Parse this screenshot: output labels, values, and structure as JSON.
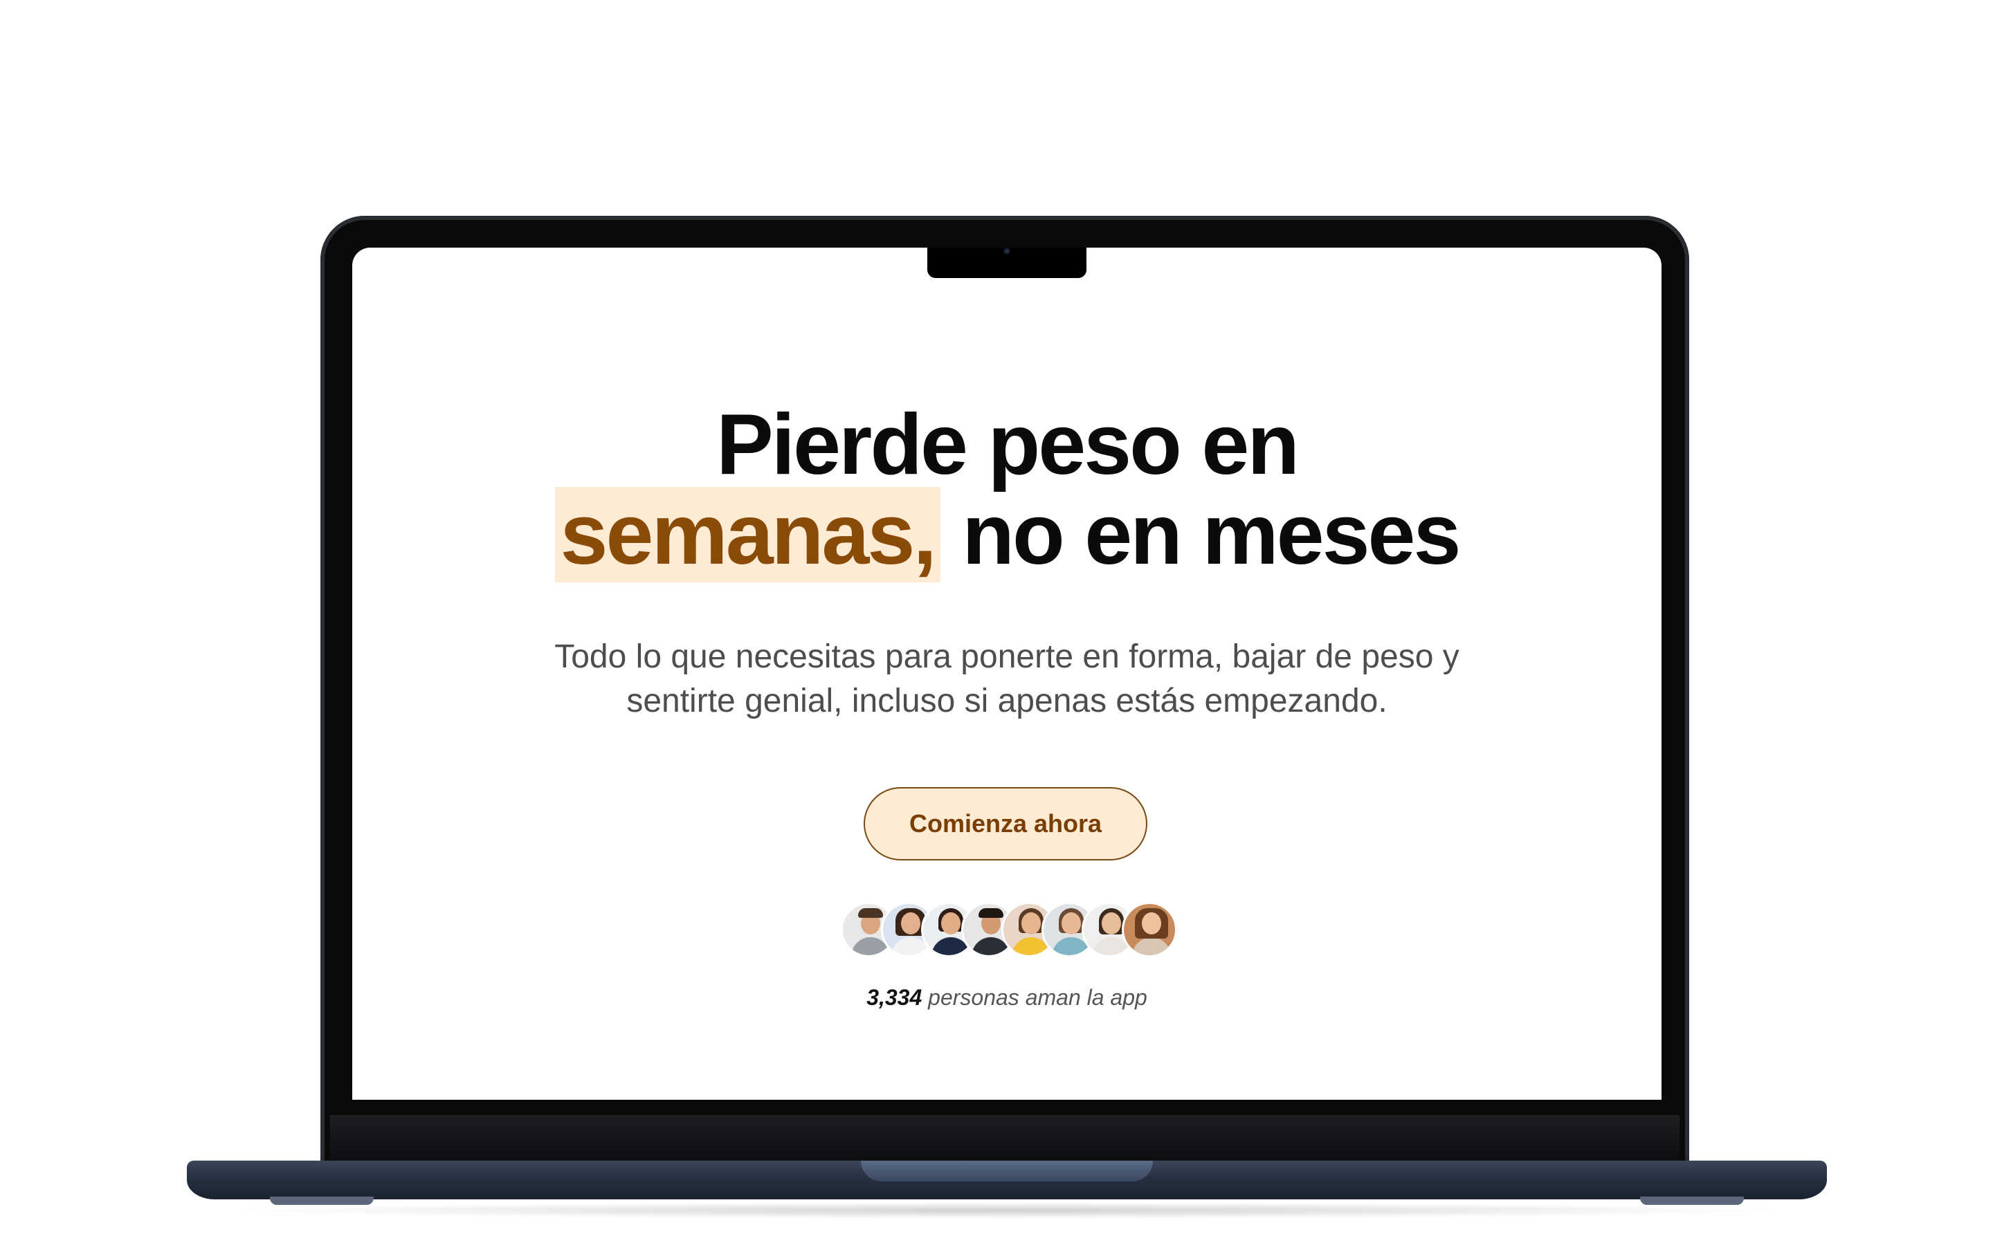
{
  "hero": {
    "headline_line1": "Pierde peso en",
    "headline_highlight": "semanas,",
    "headline_rest": " no en meses",
    "subtitle_line1": "Todo lo que necesitas para ponerte en forma, bajar de peso y",
    "subtitle_line2": "sentirte genial, incluso si apenas estás empezando.",
    "cta_label": "Comienza ahora"
  },
  "social_proof": {
    "count": "3,334",
    "text": " personas aman la app",
    "avatars": [
      {
        "icon": "user-avatar-man-gray-shirt"
      },
      {
        "icon": "user-avatar-woman-blue"
      },
      {
        "icon": "user-avatar-woman-dark-jacket"
      },
      {
        "icon": "user-avatar-man-dark-suit"
      },
      {
        "icon": "user-avatar-woman-yellow"
      },
      {
        "icon": "user-avatar-woman-teal"
      },
      {
        "icon": "user-avatar-woman-light"
      },
      {
        "icon": "user-avatar-woman-brown-hair"
      }
    ]
  },
  "colors": {
    "highlight_bg": "#fdebd3",
    "highlight_text": "#8a4a08",
    "cta_border": "#7a4a14",
    "cta_text": "#7a3e05",
    "laptop_base": "#2b3444"
  }
}
